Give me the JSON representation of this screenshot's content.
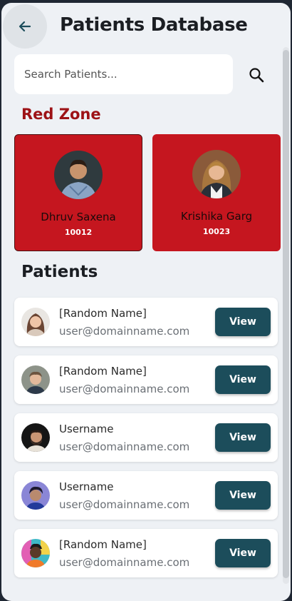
{
  "header": {
    "title": "Patients Database"
  },
  "search": {
    "placeholder": "Search Patients..."
  },
  "red_zone": {
    "title": "Red Zone",
    "patients": [
      {
        "name": "Dhruv Saxena",
        "id": "10012"
      },
      {
        "name": "Krishika Garg",
        "id": "10023"
      }
    ]
  },
  "patients": {
    "title": "Patients",
    "items": [
      {
        "name": "[Random Name]",
        "email": "user@domainname.com",
        "action": "View"
      },
      {
        "name": "[Random Name]",
        "email": "user@domainname.com",
        "action": "View"
      },
      {
        "name": "Username",
        "email": "user@domainname.com",
        "action": "View"
      },
      {
        "name": "Username",
        "email": "user@domainname.com",
        "action": "View"
      },
      {
        "name": "[Random Name]",
        "email": "user@domainname.com",
        "action": "View"
      }
    ]
  },
  "colors": {
    "accent_red": "#c5161f",
    "red_zone_heading": "#9d1216",
    "view_button": "#1c4d5b",
    "background": "#eef1f5"
  }
}
